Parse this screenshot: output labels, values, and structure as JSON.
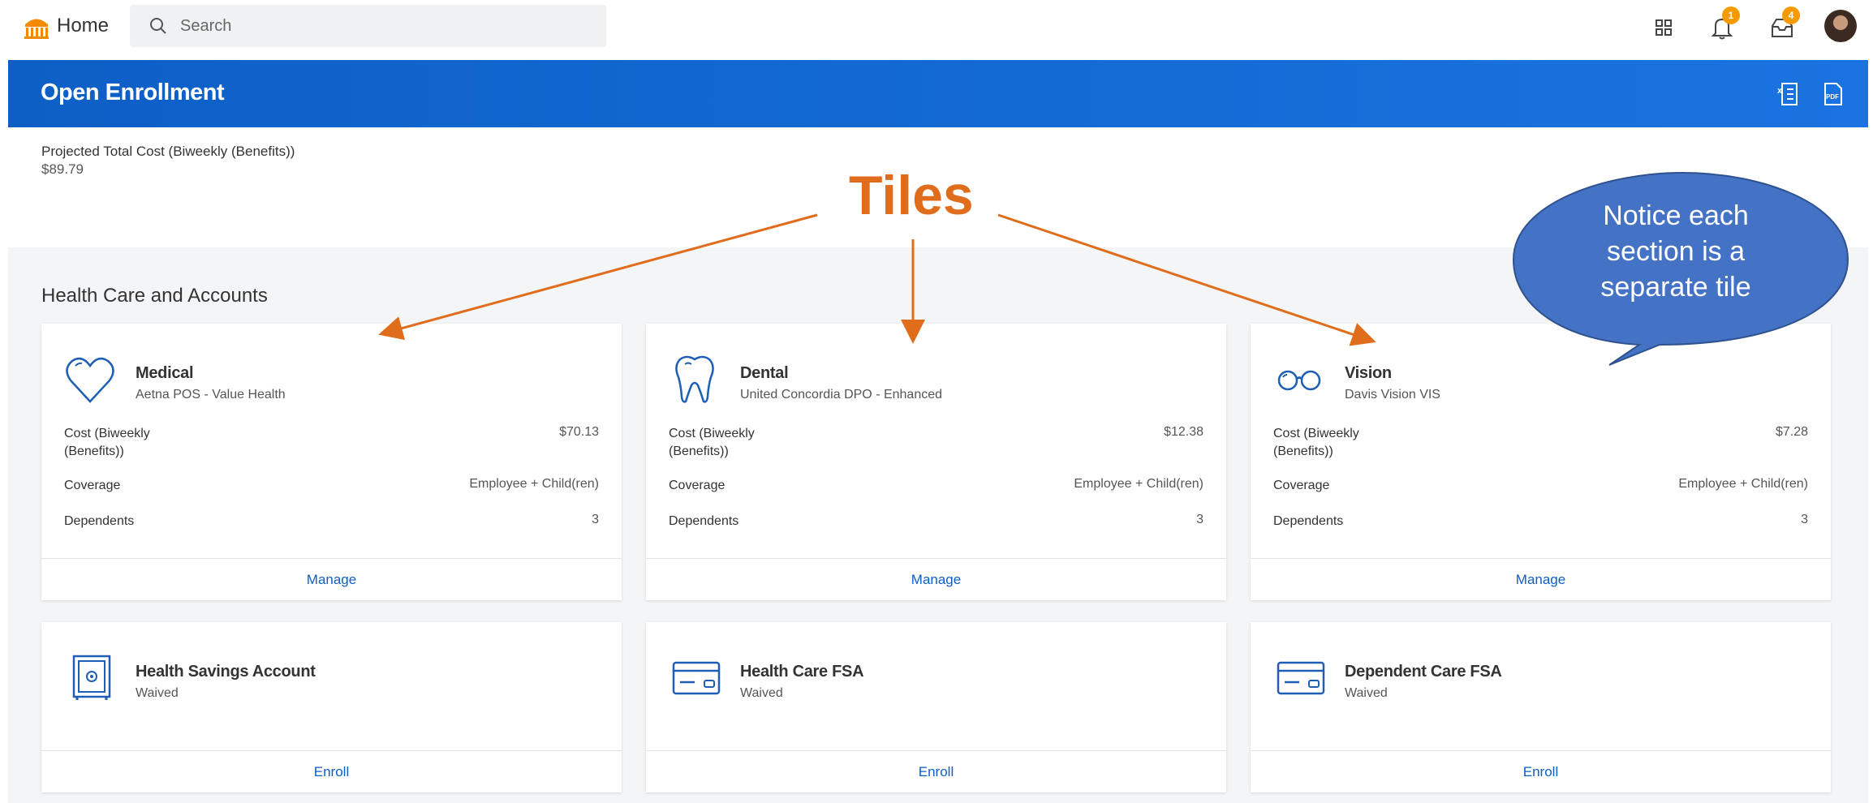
{
  "topbar": {
    "home_label": "Home",
    "search_placeholder": "Search",
    "notifications_badge": "1",
    "inbox_badge": "4"
  },
  "banner": {
    "title": "Open Enrollment",
    "excel_icon": "excel-export-icon",
    "pdf_icon": "pdf-export-icon"
  },
  "summary": {
    "label": "Projected Total Cost (Biweekly (Benefits))",
    "value": "$89.79"
  },
  "section": {
    "title": "Health Care and Accounts"
  },
  "tiles": [
    {
      "name": "Medical",
      "plan": "Aetna POS - Value Health",
      "icon": "heart-icon",
      "cost_label_1": "Cost (Biweekly",
      "cost_label_2": "(Benefits))",
      "cost": "$70.13",
      "coverage_label": "Coverage",
      "coverage": "Employee + Child(ren)",
      "dependents_label": "Dependents",
      "dependents": "3",
      "action": "Manage"
    },
    {
      "name": "Dental",
      "plan": "United Concordia DPO - Enhanced",
      "icon": "tooth-icon",
      "cost_label_1": "Cost (Biweekly",
      "cost_label_2": "(Benefits))",
      "cost": "$12.38",
      "coverage_label": "Coverage",
      "coverage": "Employee + Child(ren)",
      "dependents_label": "Dependents",
      "dependents": "3",
      "action": "Manage"
    },
    {
      "name": "Vision",
      "plan": "Davis Vision VIS",
      "icon": "glasses-icon",
      "cost_label_1": "Cost (Biweekly",
      "cost_label_2": "(Benefits))",
      "cost": "$7.28",
      "coverage_label": "Coverage",
      "coverage": "Employee + Child(ren)",
      "dependents_label": "Dependents",
      "dependents": "3",
      "action": "Manage"
    },
    {
      "name": "Health Savings Account",
      "plan": "Waived",
      "icon": "safe-icon",
      "action": "Enroll"
    },
    {
      "name": "Health Care FSA",
      "plan": "Waived",
      "icon": "credit-card-icon",
      "action": "Enroll"
    },
    {
      "name": "Dependent Care FSA",
      "plan": "Waived",
      "icon": "credit-card-icon",
      "action": "Enroll"
    }
  ],
  "annotation": {
    "tiles_label": "Tiles",
    "callout_line1": "Notice each",
    "callout_line2": "section is a",
    "callout_line3": "separate tile",
    "color": "#e06d1c",
    "callout_color": "#4472c4"
  },
  "colors": {
    "brand_blue": "#0d5fc6",
    "badge_orange": "#f59b00",
    "home_orange": "#f38b00"
  }
}
